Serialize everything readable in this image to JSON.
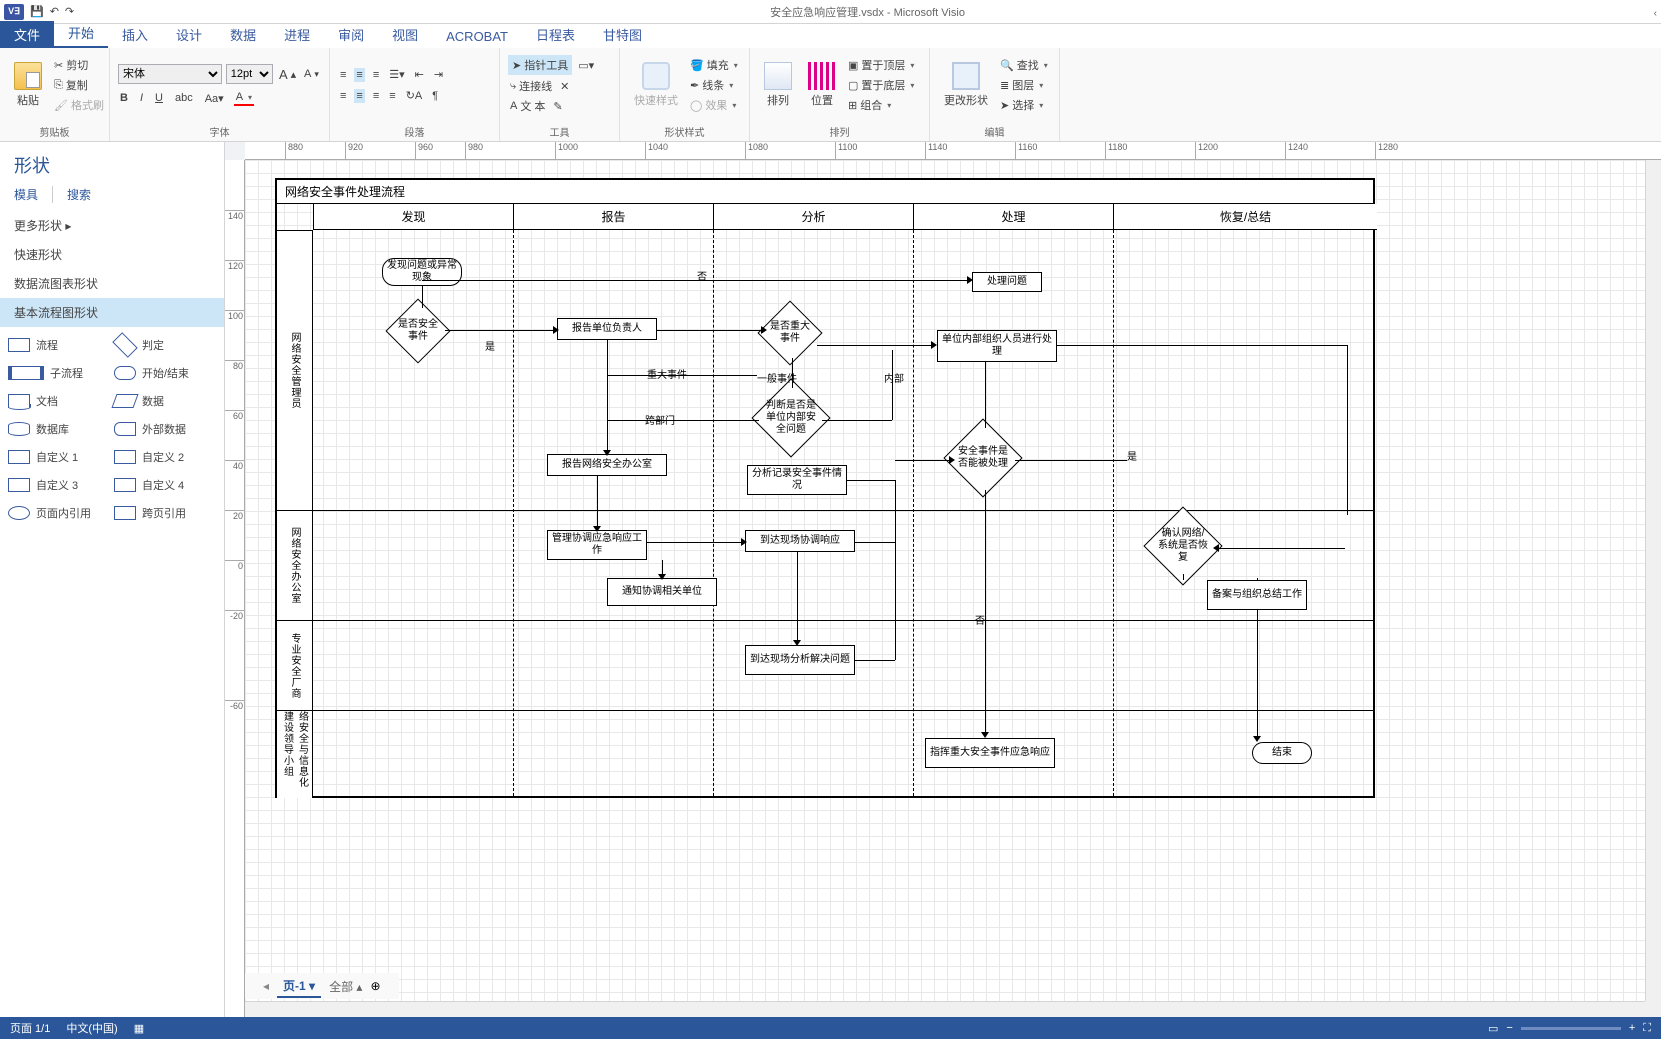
{
  "app": {
    "title_doc": "安全应急响应管理.vsdx - Microsoft Visio",
    "logo": "V∃"
  },
  "qat": {
    "save": "💾",
    "undo": "↶",
    "redo": "↷"
  },
  "tabs": [
    "文件",
    "开始",
    "插入",
    "设计",
    "数据",
    "进程",
    "审阅",
    "视图",
    "ACROBAT",
    "日程表",
    "甘特图"
  ],
  "ribbon": {
    "clipboard": {
      "paste": "粘贴",
      "cut": "剪切",
      "copy": "复制",
      "format_painter": "格式刷",
      "label": "剪贴板"
    },
    "font": {
      "family": "宋体",
      "size": "12pt",
      "label": "字体"
    },
    "paragraph": {
      "label": "段落"
    },
    "tools": {
      "pointer": "指针工具",
      "connector": "连接线",
      "text": "文 本",
      "label": "工具"
    },
    "quickstyle": {
      "btn": "快速样式",
      "label": "形状样式",
      "fill": "填充",
      "line": "线条",
      "effect": "效果"
    },
    "arrange": {
      "arrange": "排列",
      "position": "位置",
      "front": "置于顶层",
      "back": "置于底层",
      "group": "组合",
      "label": "排列"
    },
    "edit": {
      "change": "更改形状",
      "find": "查找",
      "layers": "图层",
      "select": "选择",
      "label": "编辑"
    }
  },
  "shapes_panel": {
    "title": "形状",
    "stencils_tab": "模具",
    "search_tab": "搜索",
    "more": "更多形状",
    "quick": "快速形状",
    "dfd": "数据流图表形状",
    "basic": "基本流程图形状",
    "items": [
      {
        "k": "rect",
        "label": "流程"
      },
      {
        "k": "diamond",
        "label": "判定"
      },
      {
        "k": "sub",
        "label": "子流程"
      },
      {
        "k": "term",
        "label": "开始/结束"
      },
      {
        "k": "doc",
        "label": "文档"
      },
      {
        "k": "data",
        "label": "数据"
      },
      {
        "k": "db",
        "label": "数据库"
      },
      {
        "k": "ext",
        "label": "外部数据"
      },
      {
        "k": "cust",
        "label": "自定义 1"
      },
      {
        "k": "cust",
        "label": "自定义 2"
      },
      {
        "k": "cust",
        "label": "自定义 3"
      },
      {
        "k": "cust",
        "label": "自定义 4"
      },
      {
        "k": "circ",
        "label": "页面内引用"
      },
      {
        "k": "penta",
        "label": "跨页引用"
      }
    ]
  },
  "hruler_ticks": [
    880,
    920,
    960,
    980,
    1000,
    1040,
    1080,
    1100,
    1140,
    1160,
    1180,
    1200,
    1240,
    1280
  ],
  "vruler_ticks": [
    140,
    120,
    100,
    80,
    60,
    40,
    20,
    0,
    -20,
    -60
  ],
  "diagram": {
    "title": "网络安全事件处理流程",
    "phases": [
      "发现",
      "报告",
      "分析",
      "处理",
      "恢复/总结"
    ],
    "lanes": [
      "网络安全管理员",
      "网络安全办公室",
      "专业安全厂商",
      "络安全与信息化建设领导小组"
    ],
    "nodes": {
      "start": "发现问题或异常现象",
      "d_sec": "是否安全事件",
      "rep_lead": "报告单位负责人",
      "d_major": "是否重大事件",
      "handle": "处理问题",
      "unit_internal": "单位内部组织人员进行处理",
      "d_internal": "判断是否是单位内部安全问题",
      "rep_office": "报告网络安全办公室",
      "analyze": "分析记录安全事件情况",
      "d_canhandle": "安全事件是否能被处理",
      "mgmt": "管理协调应急响应工作",
      "onsite1": "到达现场协调响应",
      "notify": "通知协调相关单位",
      "d_restore": "确认网络/系统是否恢复",
      "archive": "备案与组织总结工作",
      "onsite2": "到达现场分析解决问题",
      "command": "指挥重大安全事件应急响应",
      "end": "结束",
      "lbl_no": "否",
      "lbl_yes": "是",
      "lbl_major": "重大事件",
      "lbl_normal": "一般事件",
      "lbl_cross": "跨部门",
      "lbl_internal": "内部"
    }
  },
  "page_tabs": {
    "page": "页-1",
    "all": "全部",
    "add": "⊕"
  },
  "status": {
    "page": "页面 1/1",
    "lang": "中文(中国)"
  }
}
